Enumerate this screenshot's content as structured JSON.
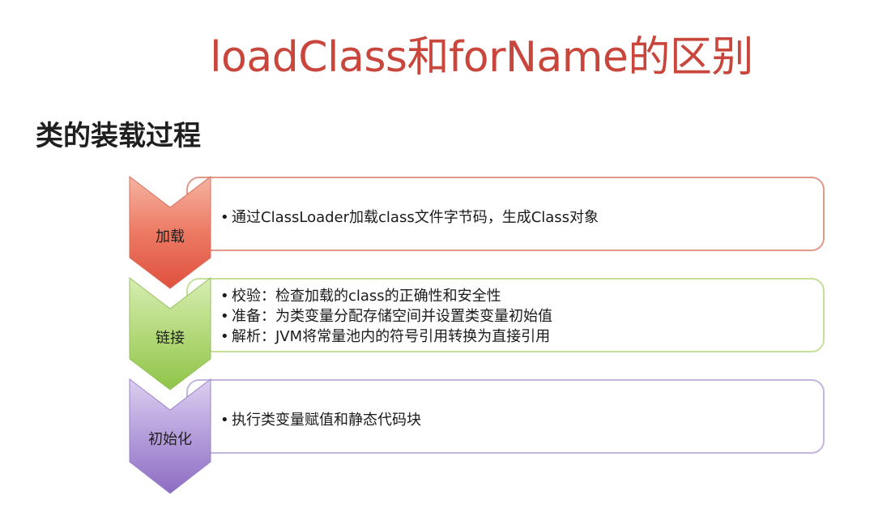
{
  "title": "loadClass和forName的区别",
  "subtitle": "类的装载过程",
  "colors": {
    "title": "#c9463c",
    "step1": "#e5604e",
    "step2": "#98c94a",
    "step3": "#9275c4"
  },
  "steps": [
    {
      "label": "加载",
      "items": [
        "通过ClassLoader加载class文件字节码，生成Class对象"
      ]
    },
    {
      "label": "链接",
      "items": [
        "校验：检查加载的class的正确性和安全性",
        "准备：为类变量分配存储空间并设置类变量初始值",
        "解析：JVM将常量池内的符号引用转换为直接引用"
      ]
    },
    {
      "label": "初始化",
      "items": [
        "执行类变量赋值和静态代码块"
      ]
    }
  ]
}
